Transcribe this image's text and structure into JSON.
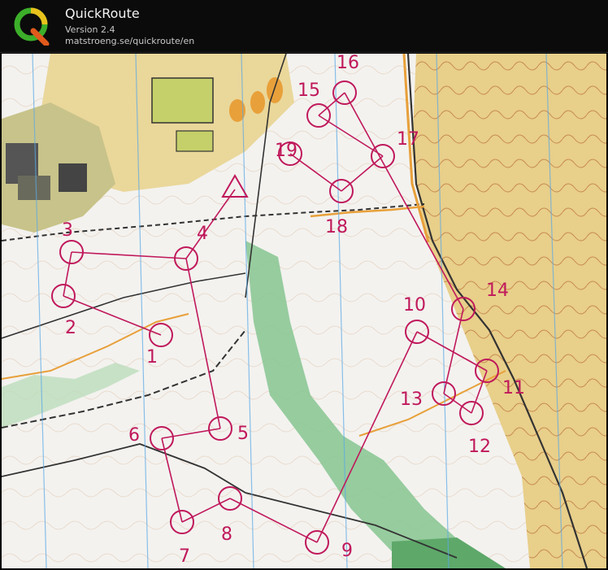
{
  "header": {
    "title": "QuickRoute",
    "version": "Version 2.4",
    "url": "matstroeng.se/quickroute/en",
    "logo_icon": "quickroute-q-logo-icon"
  },
  "map": {
    "course_color": "#c0185b",
    "controls": [
      {
        "label": "1"
      },
      {
        "label": "2"
      },
      {
        "label": "3"
      },
      {
        "label": "4"
      },
      {
        "label": "5"
      },
      {
        "label": "6"
      },
      {
        "label": "7"
      },
      {
        "label": "8"
      },
      {
        "label": "9"
      },
      {
        "label": "10"
      },
      {
        "label": "11"
      },
      {
        "label": "12"
      },
      {
        "label": "13"
      },
      {
        "label": "14"
      },
      {
        "label": "15"
      },
      {
        "label": "16"
      },
      {
        "label": "17"
      },
      {
        "label": "18"
      },
      {
        "label": "19"
      }
    ]
  }
}
